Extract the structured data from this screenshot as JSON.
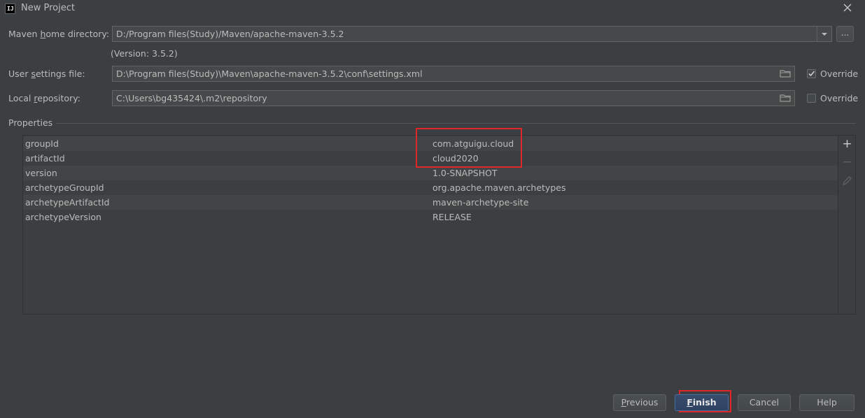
{
  "window": {
    "title": "New Project",
    "app_icon_text": "IJ"
  },
  "form": {
    "maven_home": {
      "label_pre": "Maven ",
      "label_u": "h",
      "label_post": "ome directory:",
      "value": "D:/Program files(Study)/Maven/apache-maven-3.5.2",
      "dots_label": "...",
      "version_note": "(Version: 3.5.2)"
    },
    "user_settings": {
      "label_pre": "User ",
      "label_u": "s",
      "label_post": "ettings file:",
      "value": "D:\\Program files(Study)\\Maven\\apache-maven-3.5.2\\conf\\settings.xml",
      "override_label": "Override",
      "override_checked": true
    },
    "local_repo": {
      "label_pre": "Local ",
      "label_u": "r",
      "label_post": "epository:",
      "value": "C:\\Users\\bg435424\\.m2\\repository",
      "override_label": "Override",
      "override_checked": false
    }
  },
  "properties": {
    "section_label": "Properties",
    "rows": [
      {
        "name": "groupId",
        "value": "com.atguigu.cloud"
      },
      {
        "name": "artifactId",
        "value": "cloud2020"
      },
      {
        "name": "version",
        "value": "1.0-SNAPSHOT"
      },
      {
        "name": "archetypeGroupId",
        "value": "org.apache.maven.archetypes"
      },
      {
        "name": "archetypeArtifactId",
        "value": "maven-archetype-site"
      },
      {
        "name": "archetypeVersion",
        "value": "RELEASE"
      }
    ]
  },
  "buttons": {
    "previous": {
      "u": "P",
      "rest": "revious"
    },
    "finish": {
      "u": "F",
      "rest": "inish"
    },
    "cancel": "Cancel",
    "help": "Help"
  },
  "icons": {
    "close": "close-icon",
    "add": "add-icon",
    "remove": "remove-icon",
    "edit": "edit-icon",
    "folder": "folder-icon",
    "dropdown": "chevron-down-icon",
    "check": "checkmark-icon"
  },
  "colors": {
    "background": "#3c3f41",
    "highlight_box": "#e0262a",
    "primary_button": "#365880"
  }
}
